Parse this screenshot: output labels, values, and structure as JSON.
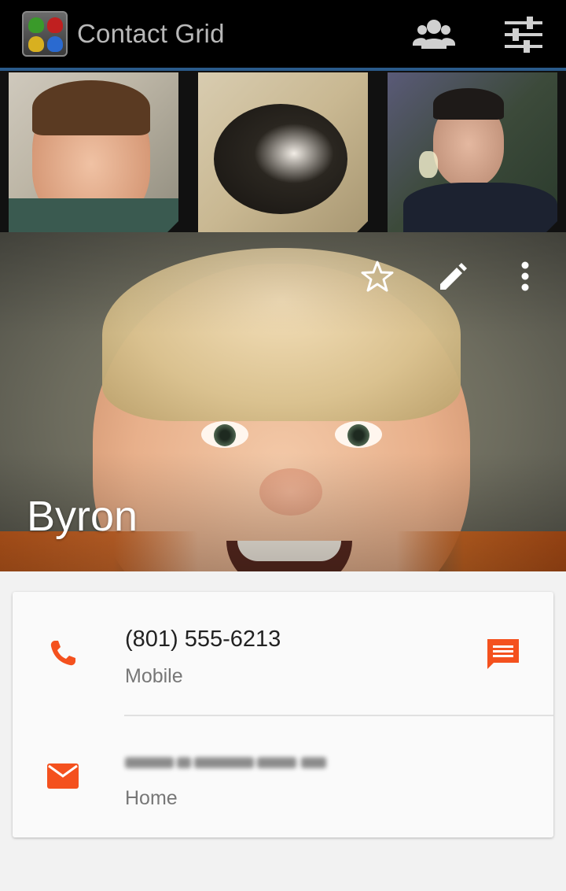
{
  "action_bar": {
    "title": "Contact Grid",
    "app_icon": "android-grid-icon",
    "actions": [
      {
        "icon": "contacts-group-icon"
      },
      {
        "icon": "settings-sliders-icon"
      }
    ],
    "divider_color": "#2a5a8a"
  },
  "grid": {
    "tiles": [
      {
        "photo": "man-portrait"
      },
      {
        "photo": "cat-photo"
      },
      {
        "photo": "man-gesture-photo"
      }
    ]
  },
  "contact": {
    "name": "Byron",
    "actions": [
      {
        "icon": "star-outline-icon"
      },
      {
        "icon": "edit-pencil-icon"
      },
      {
        "icon": "overflow-menu-icon"
      }
    ],
    "phone": {
      "number": "(801) 555-6213",
      "label": "Mobile",
      "icon": "phone-icon",
      "action_icon": "message-icon"
    },
    "email": {
      "label": "Home",
      "icon": "email-icon"
    }
  },
  "colors": {
    "accent": "#f4511e",
    "action_bar_bg": "#000000",
    "card_bg": "#fafafa"
  }
}
